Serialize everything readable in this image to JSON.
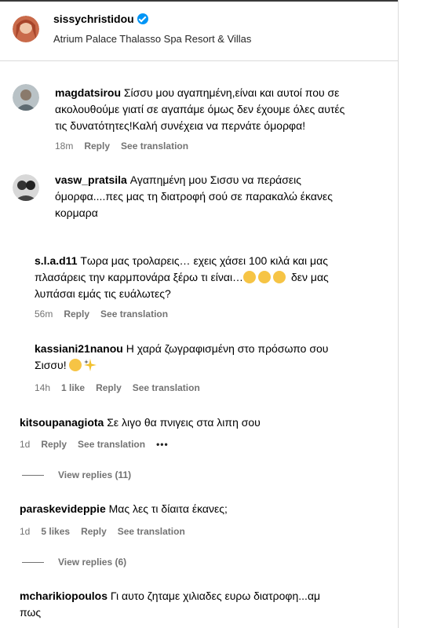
{
  "post": {
    "owner": "sissychristidou",
    "location": "Atrium Palace Thalasso Spa Resort & Villas"
  },
  "comments": [
    {
      "user": "magdatsirou",
      "line1": "Σίσσυ μου αγαπημένη,είναι και αυτοί που σε",
      "line2": "ακολουθούμε γιατί σε αγαπάμε όμως δεν έχουμε όλες αυτές",
      "line3": "τις δυνατότητες!Καλή συνέχεια να περνάτε όμορφα!",
      "time": "18m",
      "reply": "Reply",
      "translate": "See translation"
    },
    {
      "user": "vasw_pratsila",
      "line1": "Αγαπημένη μου Σισσυ να περάσεις",
      "line2": "όμορφα....πες μας τη διατροφή σού σε παρακαλώ έκανες",
      "line3": "κορμαρα"
    },
    {
      "user": "s.l.a.d11",
      "line1": "Τωρα μας τρολαρεις… εχεις χάσει 100 κιλά και μας",
      "line2": "πλασάρεις την καρμπονάρα ξέρω τι είναι…",
      "line3": "δεν μας",
      "line4": "λυπάσαι εμάς τις ευάλωτες?",
      "time": "56m",
      "reply": "Reply",
      "translate": "See translation"
    },
    {
      "user": "kassiani21nanou",
      "line1": "Η χαρά ζωγραφισμένη στο πρόσωπο σου",
      "line2": "Σισσυ!",
      "time": "14h",
      "likes": "1 like",
      "reply": "Reply",
      "translate": "See translation"
    },
    {
      "user": "kitsoupanagiota",
      "line1": "Σε λιγο θα πνιγεις στα λιπη σου",
      "time": "1d",
      "reply": "Reply",
      "translate": "See translation",
      "more": "•••",
      "view_replies": "View replies (11)"
    },
    {
      "user": "paraskevideppie",
      "line1": "Μας λες τι δίαιτα έκανες;",
      "time": "1d",
      "likes": "5 likes",
      "reply": "Reply",
      "translate": "See translation",
      "view_replies": "View replies (6)"
    },
    {
      "user": "mcharikiopoulos",
      "line1": "Γι αυτο ζηταμε χιλιαδες ευρω διατροφη...αμ",
      "line2": "πως"
    }
  ],
  "colors": {
    "verified": "#0095f6",
    "meta": "#737373",
    "divider": "#dbdbdb"
  }
}
